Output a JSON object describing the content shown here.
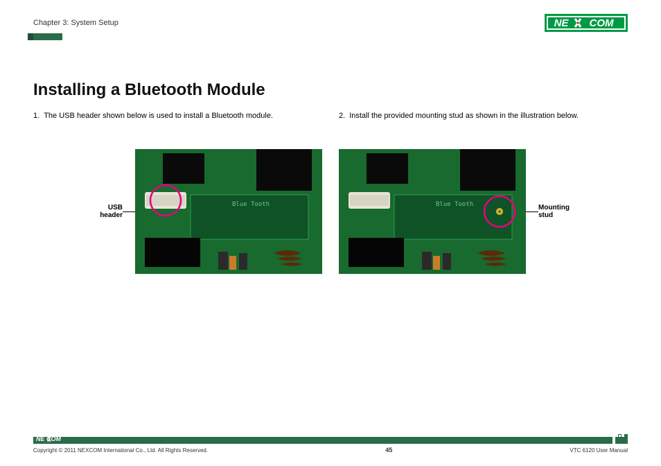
{
  "header": {
    "chapter": "Chapter 3: System Setup",
    "logo_text_left": "NE",
    "logo_text_right": "COM"
  },
  "title": "Installing a Bluetooth Module",
  "steps": [
    {
      "num": "1.",
      "text": "The USB header shown below is used to install a Bluetooth module."
    },
    {
      "num": "2.",
      "text": "Install the provided mounting stud as shown in the illustration below."
    }
  ],
  "figures": {
    "left": {
      "callout_line1": "USB",
      "callout_line2": "header",
      "board_label": "Blue Tooth"
    },
    "right": {
      "callout_line1": "Mounting",
      "callout_line2": "stud",
      "board_label": "Blue Tooth"
    }
  },
  "footer": {
    "copyright": "Copyright © 2011 NEXCOM International Co., Ltd. All Rights Reserved.",
    "page_number": "45",
    "doc_title": "VTC 6120 User Manual"
  }
}
